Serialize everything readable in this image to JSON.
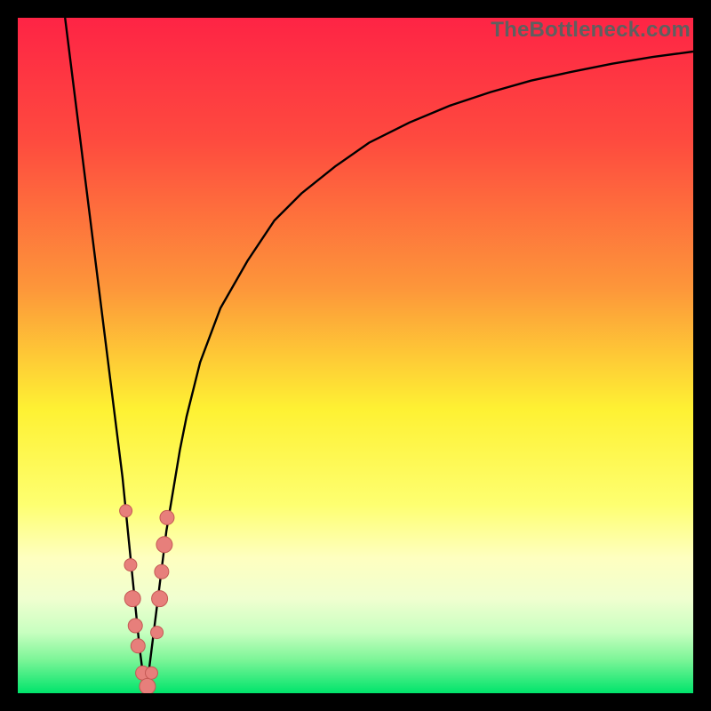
{
  "watermark": "TheBottleneck.com",
  "colors": {
    "frame": "#000000",
    "curve": "#000000",
    "dots_fill": "#e77f7b",
    "dots_stroke": "#c45954",
    "gradient_top": "#fe2445",
    "gradient_mid_upper": "#fd8b3a",
    "gradient_mid": "#fef635",
    "gradient_lower": "#feff9c",
    "gradient_band": "#f0ffc2",
    "gradient_bottom": "#00e46b"
  },
  "chart_data": {
    "type": "line",
    "title": "",
    "xlabel": "",
    "ylabel": "",
    "xlim": [
      0,
      100
    ],
    "ylim": [
      0,
      100
    ],
    "vertex_x": 19,
    "series": [
      {
        "name": "left-branch",
        "x": [
          7.0,
          8.0,
          9.0,
          10.0,
          11.0,
          12.0,
          13.0,
          14.0,
          15.0,
          15.5,
          16.0,
          16.5,
          17.0,
          17.5,
          18.0,
          18.5,
          19.0
        ],
        "y": [
          100,
          92,
          84,
          76,
          68,
          60,
          52,
          44,
          36,
          32,
          27,
          22,
          17,
          12,
          7,
          3,
          0
        ]
      },
      {
        "name": "right-branch",
        "x": [
          19.0,
          19.5,
          20.0,
          20.5,
          21.0,
          21.5,
          22.0,
          23.0,
          24.0,
          25.0,
          27.0,
          30.0,
          34.0,
          38.0,
          42.0,
          47.0,
          52.0,
          58.0,
          64.0,
          70.0,
          76.0,
          82.0,
          88.0,
          94.0,
          100.0
        ],
        "y": [
          0,
          4,
          8,
          12,
          16,
          20,
          24,
          30,
          36,
          41,
          49,
          57,
          64,
          70,
          74,
          78,
          81.5,
          84.5,
          87,
          89,
          90.7,
          92,
          93.2,
          94.2,
          95
        ]
      }
    ],
    "scatter": [
      {
        "x": 16.0,
        "y": 27,
        "r": 7
      },
      {
        "x": 16.7,
        "y": 19,
        "r": 7
      },
      {
        "x": 17.0,
        "y": 14,
        "r": 9
      },
      {
        "x": 17.4,
        "y": 10,
        "r": 8
      },
      {
        "x": 17.8,
        "y": 7,
        "r": 8
      },
      {
        "x": 18.5,
        "y": 3,
        "r": 8
      },
      {
        "x": 19.2,
        "y": 1,
        "r": 9
      },
      {
        "x": 19.8,
        "y": 3,
        "r": 7
      },
      {
        "x": 21.7,
        "y": 22,
        "r": 9
      },
      {
        "x": 22.1,
        "y": 26,
        "r": 8
      },
      {
        "x": 21.3,
        "y": 18,
        "r": 8
      },
      {
        "x": 21.0,
        "y": 14,
        "r": 9
      },
      {
        "x": 20.6,
        "y": 9,
        "r": 7
      }
    ],
    "gradient_stops": [
      {
        "offset": 0.0,
        "color": "#fe2445"
      },
      {
        "offset": 0.18,
        "color": "#fe4a3f"
      },
      {
        "offset": 0.4,
        "color": "#fd963a"
      },
      {
        "offset": 0.58,
        "color": "#fef133"
      },
      {
        "offset": 0.72,
        "color": "#feff70"
      },
      {
        "offset": 0.8,
        "color": "#feffc0"
      },
      {
        "offset": 0.86,
        "color": "#f0ffd0"
      },
      {
        "offset": 0.91,
        "color": "#c8ffc0"
      },
      {
        "offset": 0.95,
        "color": "#7df598"
      },
      {
        "offset": 1.0,
        "color": "#00e46b"
      }
    ]
  }
}
